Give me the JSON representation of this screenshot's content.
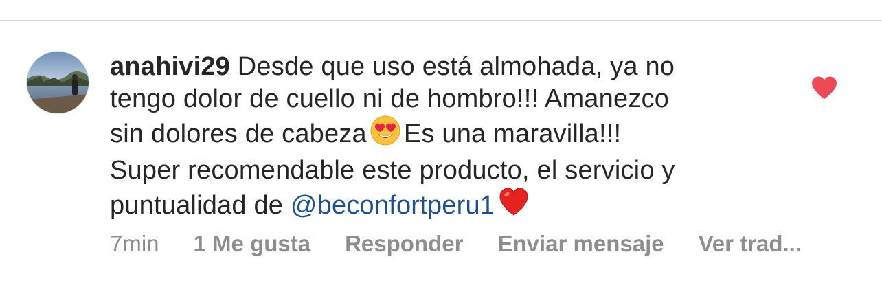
{
  "comment": {
    "username": "anahivi29",
    "line1_text": "Desde que uso está almohada, ya no",
    "line2_text": "tengo dolor de cuello ni  de hombro!!! Amanezco",
    "line3_before_emoji": "sin dolores de cabeza",
    "line3_after_emoji": "Es una maravilla!!!",
    "line4_text": "Super recomendable este producto, el servicio y",
    "line5_before_mention": "puntualidad de",
    "mention": "@beconfortperu1",
    "emoji_icons": [
      "heart-eyes-emoji",
      "red-heart-emoji"
    ]
  },
  "actions": {
    "time": "7min",
    "likes": "1 Me gusta",
    "reply": "Responder",
    "send": "Enviar mensaje",
    "translate": "Ver trad..."
  },
  "colors": {
    "text": "#262626",
    "mention": "#1d4f91",
    "secondary": "#8e8e8e",
    "like_heart": "#ed4956"
  },
  "icons": {
    "like": "heart-icon",
    "avatar": "avatar"
  }
}
